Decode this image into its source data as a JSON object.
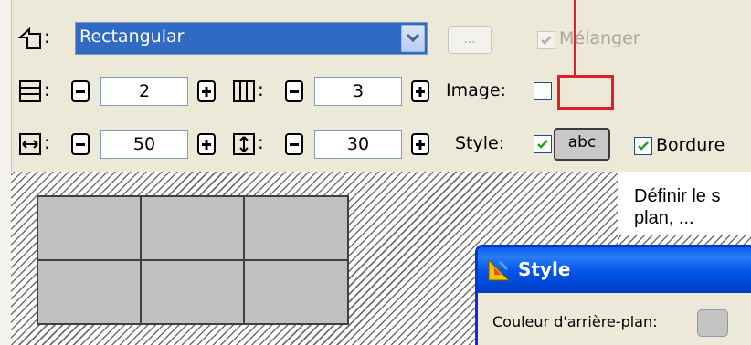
{
  "toolbar": {
    "colon": ":",
    "shape_select": {
      "value": "Rectangular"
    },
    "more_button": {
      "label": "..."
    },
    "blend": {
      "label": "Mélanger",
      "checked": true,
      "enabled": false
    },
    "rows": {
      "value": "2",
      "minus": "-",
      "plus": "+"
    },
    "columns": {
      "value": "3",
      "minus": "-",
      "plus": "+"
    },
    "image": {
      "label": "Image:",
      "checked": false
    },
    "width": {
      "value": "50"
    },
    "height": {
      "value": "30"
    },
    "style": {
      "label": "Style:",
      "checked": true,
      "button_label": "abc"
    },
    "border": {
      "label": "Bordure",
      "checked": true
    }
  },
  "preview": {
    "grid_rows": 2,
    "grid_columns": 3
  },
  "tooltip": {
    "line1": "Définir le s",
    "line2": "plan, ..."
  },
  "style_dialog": {
    "title": "Style",
    "background_color_label": "Couleur d'arrière-plan:"
  },
  "colors": {
    "selection": "#316ac5",
    "highlight_box": "#e01f27",
    "titlebar": "#0053e3",
    "cell_fill": "#c0c0c0"
  }
}
